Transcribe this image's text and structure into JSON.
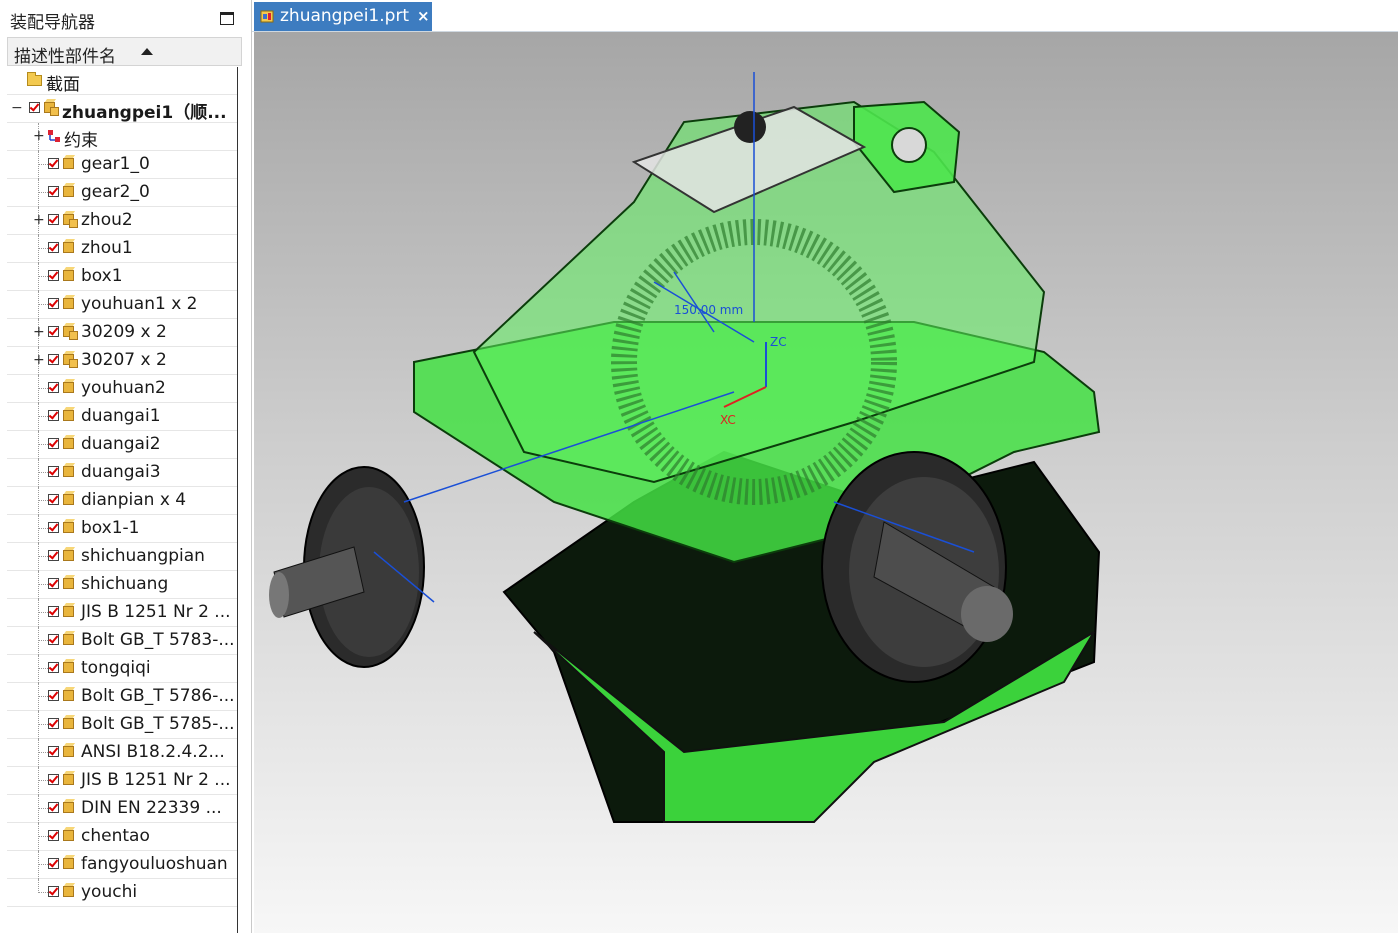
{
  "navigator": {
    "title": "装配导航器",
    "column_header": "描述性部件名",
    "section_label": "截面",
    "root": {
      "label": "zhuangpei1（顺...",
      "checked": true,
      "expanded": true
    },
    "constraints_label": "约束",
    "items": [
      {
        "label": "gear1_0",
        "checked": true,
        "subassembly": false
      },
      {
        "label": "gear2_0",
        "checked": true,
        "subassembly": false
      },
      {
        "label": "zhou2",
        "checked": true,
        "subassembly": true
      },
      {
        "label": "zhou1",
        "checked": true,
        "subassembly": false
      },
      {
        "label": "box1",
        "checked": true,
        "subassembly": false
      },
      {
        "label": "youhuan1 x 2",
        "checked": true,
        "subassembly": false
      },
      {
        "label": "30209 x 2",
        "checked": true,
        "subassembly": true
      },
      {
        "label": "30207 x 2",
        "checked": true,
        "subassembly": true
      },
      {
        "label": "youhuan2",
        "checked": true,
        "subassembly": false
      },
      {
        "label": "duangai1",
        "checked": true,
        "subassembly": false
      },
      {
        "label": "duangai2",
        "checked": true,
        "subassembly": false
      },
      {
        "label": "duangai3",
        "checked": true,
        "subassembly": false
      },
      {
        "label": "dianpian x 4",
        "checked": true,
        "subassembly": false
      },
      {
        "label": "box1-1",
        "checked": true,
        "subassembly": false
      },
      {
        "label": "shichuangpian",
        "checked": true,
        "subassembly": false
      },
      {
        "label": "shichuang",
        "checked": true,
        "subassembly": false
      },
      {
        "label": "JIS B 1251 Nr 2 ...",
        "checked": true,
        "subassembly": false
      },
      {
        "label": "Bolt GB_T 5783-...",
        "checked": true,
        "subassembly": false
      },
      {
        "label": "tongqiqi",
        "checked": true,
        "subassembly": false
      },
      {
        "label": "Bolt GB_T 5786-...",
        "checked": true,
        "subassembly": false
      },
      {
        "label": "Bolt GB_T 5785-...",
        "checked": true,
        "subassembly": false
      },
      {
        "label": "ANSI B18.2.4.2...",
        "checked": true,
        "subassembly": false
      },
      {
        "label": "JIS B 1251 Nr 2 ...",
        "checked": true,
        "subassembly": false
      },
      {
        "label": "DIN EN 22339 ...",
        "checked": true,
        "subassembly": false
      },
      {
        "label": "chentao",
        "checked": true,
        "subassembly": false
      },
      {
        "label": "fangyouluoshuan",
        "checked": true,
        "subassembly": false
      },
      {
        "label": "youchi",
        "checked": true,
        "subassembly": false
      }
    ]
  },
  "tab": {
    "label": "zhuangpei1.prt",
    "close": "×",
    "color": "#3d7cc0"
  },
  "viewport": {
    "triad": {
      "zc": "ZC",
      "xc": "XC"
    },
    "dimension": "150.00 mm",
    "model_color": "#3ddb3d"
  }
}
